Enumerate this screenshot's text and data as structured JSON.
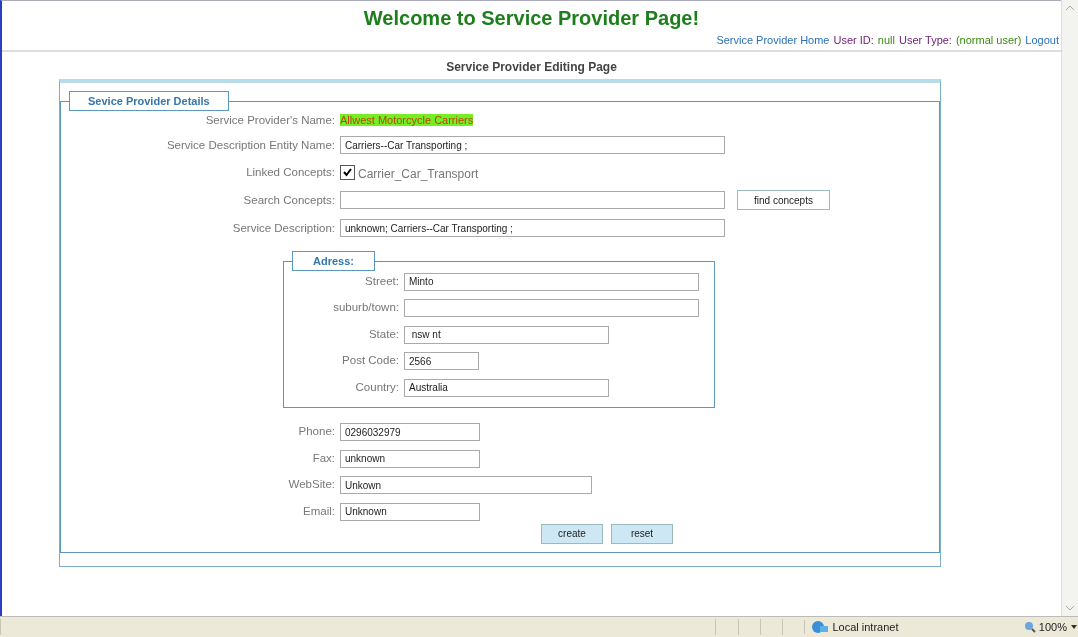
{
  "header": {
    "title": "Welcome to Service Provider Page!",
    "nav": [
      {
        "text": "Service Provider Home",
        "kind": "link"
      },
      {
        "text": "User ID:",
        "kind": "label"
      },
      {
        "text": "null",
        "kind": "value"
      },
      {
        "text": "User Type:",
        "kind": "label"
      },
      {
        "text": "(normal user)",
        "kind": "value"
      },
      {
        "text": "Logout",
        "kind": "link"
      }
    ]
  },
  "page_heading": "Service Provider Editing Page",
  "details": {
    "legend": "Sevice Provider Details",
    "rows": [
      {
        "kind": "highlight",
        "label": "Service Provider's Name:",
        "value": "Allwest Motorcycle Carriers"
      },
      {
        "kind": "input",
        "label": "Service Description Entity Name:",
        "value": "Carriers--Car Transporting ;"
      },
      {
        "kind": "checkbox",
        "label": "Linked Concepts:",
        "checked": true,
        "value": "Carrier_Car_Transport"
      },
      {
        "kind": "search",
        "label": "Search Concepts:",
        "button": "find concepts"
      },
      {
        "kind": "input",
        "label": "Service Description:",
        "value": "unknown; Carriers--Car Transporting ;"
      }
    ]
  },
  "address": {
    "legend": "Adress:",
    "fields": [
      {
        "label": "Street:",
        "value": "Minto"
      },
      {
        "label": "suburb/town:"
      },
      {
        "label": "State:",
        "value": " nsw nt"
      },
      {
        "label": "Post Code:",
        "value": "2566"
      },
      {
        "label": "Country:",
        "value": "Australia"
      }
    ]
  },
  "contact": [
    {
      "label": "Phone:",
      "value": "0296032979"
    },
    {
      "label": "Fax:",
      "value": "unknown"
    },
    {
      "label": "WebSite:",
      "value": "Unkown"
    },
    {
      "label": "Email:",
      "value": "Unknown"
    }
  ],
  "buttons": [
    "create",
    "reset"
  ],
  "status_bar": {
    "zone": "Local intranet",
    "zoom": "100%"
  }
}
